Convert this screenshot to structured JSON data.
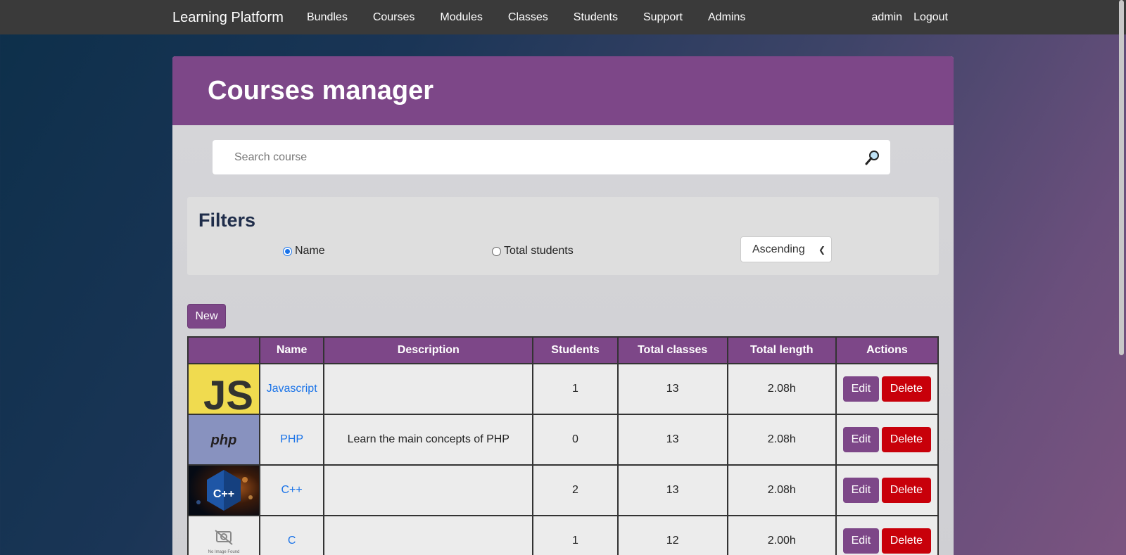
{
  "nav": {
    "brand": "Learning Platform",
    "links": [
      "Bundles",
      "Courses",
      "Modules",
      "Classes",
      "Students",
      "Support",
      "Admins"
    ],
    "user": "admin",
    "logout": "Logout"
  },
  "page": {
    "title": "Courses manager"
  },
  "search": {
    "placeholder": "Search course",
    "value": ""
  },
  "filters": {
    "title": "Filters",
    "options": [
      "Name",
      "Total students"
    ],
    "selected": "Name",
    "order": "Ascending"
  },
  "actions": {
    "new_label": "New",
    "edit_label": "Edit",
    "delete_label": "Delete"
  },
  "table": {
    "headers": [
      "",
      "Name",
      "Description",
      "Students",
      "Total classes",
      "Total length",
      "Actions"
    ],
    "rows": [
      {
        "image": "JS",
        "name": "Javascript",
        "description": "",
        "students": "1",
        "classes": "13",
        "length": "2.08h"
      },
      {
        "image": "php",
        "name": "PHP",
        "description": "Learn the main concepts of PHP",
        "students": "0",
        "classes": "13",
        "length": "2.08h"
      },
      {
        "image": "C++",
        "name": "C++",
        "description": "",
        "students": "2",
        "classes": "13",
        "length": "2.08h"
      },
      {
        "image": "No Image Found",
        "name": "C",
        "description": "",
        "students": "1",
        "classes": "12",
        "length": "2.00h"
      }
    ]
  },
  "colors": {
    "accent": "#7d4788",
    "danger": "#c8000a",
    "link": "#1a73e8",
    "navbar": "#3a3a3a"
  }
}
